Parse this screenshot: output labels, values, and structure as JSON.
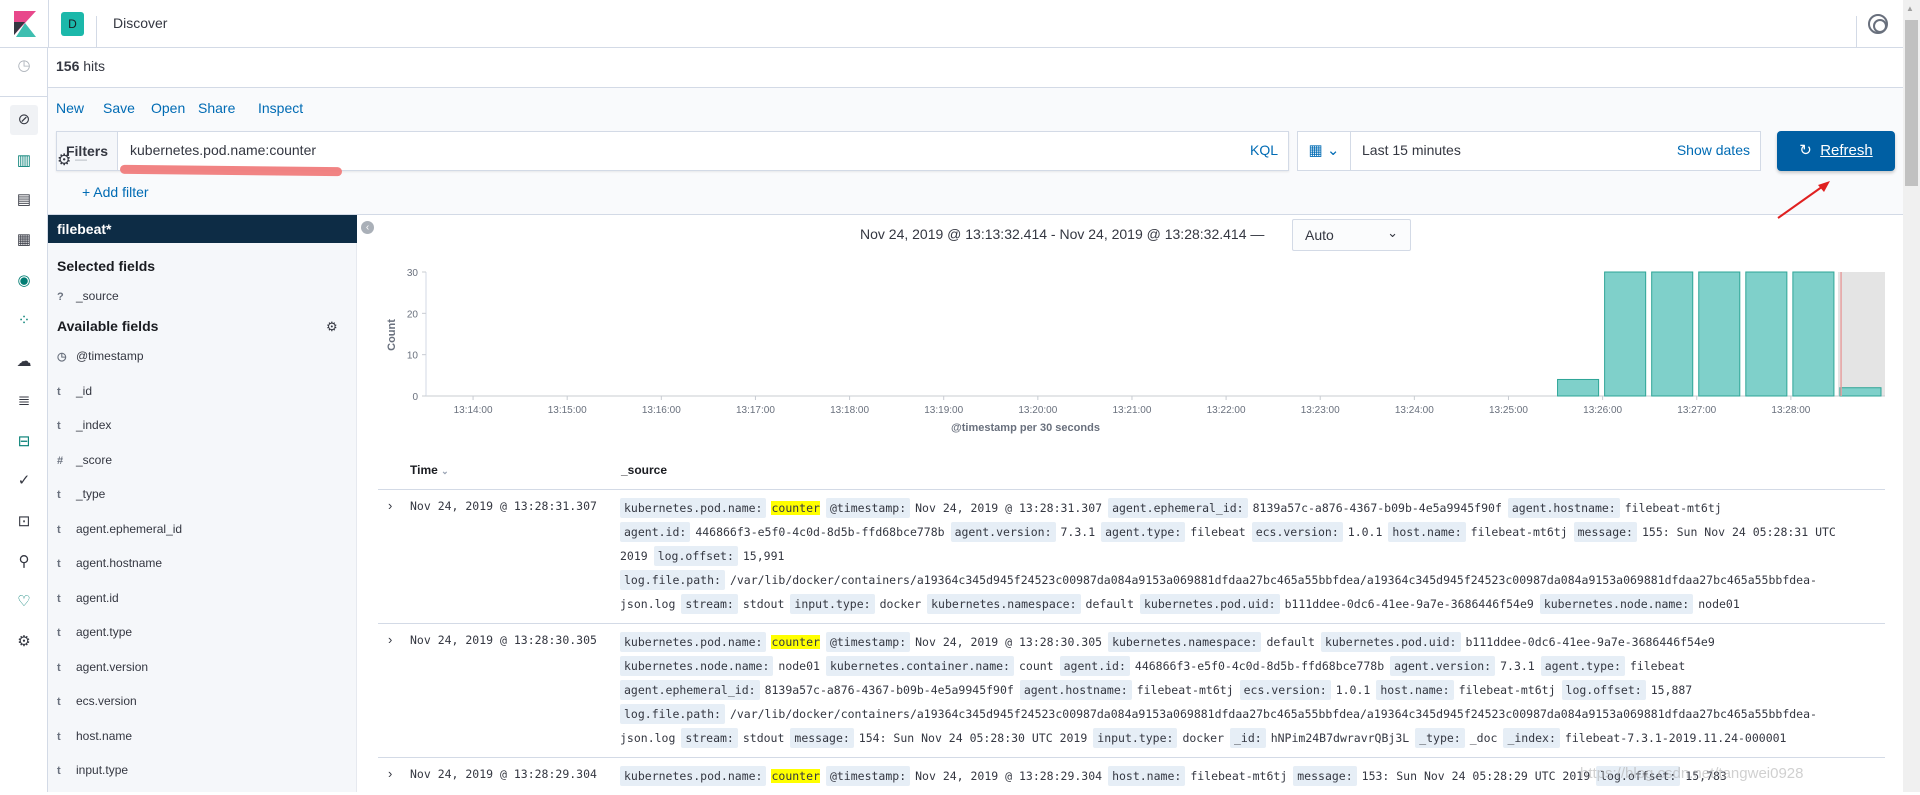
{
  "header": {
    "avatar_letter": "D",
    "title": "Discover"
  },
  "hits": {
    "count": "156",
    "label": "hits"
  },
  "toolbar": {
    "new": "New",
    "save": "Save",
    "open": "Open",
    "share": "Share",
    "inspect": "Inspect"
  },
  "query": {
    "filters_label": "Filters",
    "value": "kubernetes.pod.name:counter",
    "language": "KQL",
    "add_filter": "+ Add filter"
  },
  "time": {
    "quick": "Last 15 minutes",
    "show_dates": "Show dates",
    "refresh": "Refresh"
  },
  "sidebar": {
    "index_pattern": "filebeat*",
    "selected_title": "Selected fields",
    "selected": [
      {
        "type": "?",
        "name": "_source"
      }
    ],
    "available_title": "Available fields",
    "available": [
      {
        "type": "clock",
        "name": "@timestamp"
      },
      {
        "type": "t",
        "name": "_id"
      },
      {
        "type": "t",
        "name": "_index"
      },
      {
        "type": "#",
        "name": "_score"
      },
      {
        "type": "t",
        "name": "_type"
      },
      {
        "type": "t",
        "name": "agent.ephemeral_id"
      },
      {
        "type": "t",
        "name": "agent.hostname"
      },
      {
        "type": "t",
        "name": "agent.id"
      },
      {
        "type": "t",
        "name": "agent.type"
      },
      {
        "type": "t",
        "name": "agent.version"
      },
      {
        "type": "t",
        "name": "ecs.version"
      },
      {
        "type": "t",
        "name": "host.name"
      },
      {
        "type": "t",
        "name": "input.type"
      }
    ]
  },
  "histogram": {
    "range": "Nov 24, 2019 @ 13:13:32.414 - Nov 24, 2019 @ 13:28:32.414 —",
    "interval": "Auto"
  },
  "chart_data": {
    "type": "bar",
    "xlabel": "@timestamp per 30 seconds",
    "ylabel": "Count",
    "xlim": [
      "13:13:30",
      "13:29:00"
    ],
    "ylim": [
      0,
      30
    ],
    "y_ticks": [
      0,
      10,
      20,
      30
    ],
    "x_ticks": [
      "13:14:00",
      "13:15:00",
      "13:16:00",
      "13:17:00",
      "13:18:00",
      "13:19:00",
      "13:20:00",
      "13:21:00",
      "13:22:00",
      "13:23:00",
      "13:24:00",
      "13:25:00",
      "13:26:00",
      "13:27:00",
      "13:28:00"
    ],
    "x": [
      "13:25:30",
      "13:26:00",
      "13:26:30",
      "13:27:00",
      "13:27:30",
      "13:28:00",
      "13:28:30"
    ],
    "values": [
      4,
      30,
      30,
      30,
      30,
      30,
      2
    ],
    "partial_bucket_from": "13:28:30",
    "now_marker": "13:28:32",
    "bar_color": "#7fd0ca",
    "bar_stroke": "#2ea597"
  },
  "table": {
    "headers": {
      "time": "Time",
      "source": "_source"
    },
    "rows": [
      {
        "time": "Nov 24, 2019 @ 13:28:31.307",
        "lines": [
          [
            {
              "k": "kubernetes.pod.name:",
              "v": "counter",
              "hl": true
            },
            {
              "k": "@timestamp:",
              "v": "Nov 24, 2019 @ 13:28:31.307"
            },
            {
              "k": "agent.ephemeral_id:",
              "v": "8139a57c-a876-4367-b09b-4e5a9945f90f"
            },
            {
              "k": "agent.hostname:",
              "v": "filebeat-mt6tj"
            }
          ],
          [
            {
              "k": "agent.id:",
              "v": "446866f3-e5f0-4c0d-8d5b-ffd68bce778b"
            },
            {
              "k": "agent.version:",
              "v": "7.3.1"
            },
            {
              "k": "agent.type:",
              "v": "filebeat"
            },
            {
              "k": "ecs.version:",
              "v": "1.0.1"
            },
            {
              "k": "host.name:",
              "v": "filebeat-mt6tj"
            },
            {
              "k": "message:",
              "v": "155: Sun Nov 24 05:28:31 UTC"
            }
          ],
          [
            {
              "v": "2019"
            },
            {
              "k": "log.offset:",
              "v": "15,991"
            }
          ],
          [
            {
              "k": "log.file.path:",
              "v": "/var/lib/docker/containers/a19364c345d945f24523c00987da084a9153a069881dfdaa27bc465a55bbfdea/a19364c345d945f24523c00987da084a9153a069881dfdaa27bc465a55bbfdea-"
            }
          ],
          [
            {
              "v": "json.log"
            },
            {
              "k": "stream:",
              "v": "stdout"
            },
            {
              "k": "input.type:",
              "v": "docker"
            },
            {
              "k": "kubernetes.namespace:",
              "v": "default"
            },
            {
              "k": "kubernetes.pod.uid:",
              "v": "b111ddee-0dc6-41ee-9a7e-3686446f54e9"
            },
            {
              "k": "kubernetes.node.name:",
              "v": "node01"
            }
          ]
        ]
      },
      {
        "time": "Nov 24, 2019 @ 13:28:30.305",
        "lines": [
          [
            {
              "k": "kubernetes.pod.name:",
              "v": "counter",
              "hl": true
            },
            {
              "k": "@timestamp:",
              "v": "Nov 24, 2019 @ 13:28:30.305"
            },
            {
              "k": "kubernetes.namespace:",
              "v": "default"
            },
            {
              "k": "kubernetes.pod.uid:",
              "v": "b111ddee-0dc6-41ee-9a7e-3686446f54e9"
            }
          ],
          [
            {
              "k": "kubernetes.node.name:",
              "v": "node01"
            },
            {
              "k": "kubernetes.container.name:",
              "v": "count"
            },
            {
              "k": "agent.id:",
              "v": "446866f3-e5f0-4c0d-8d5b-ffd68bce778b"
            },
            {
              "k": "agent.version:",
              "v": "7.3.1"
            },
            {
              "k": "agent.type:",
              "v": "filebeat"
            }
          ],
          [
            {
              "k": "agent.ephemeral_id:",
              "v": "8139a57c-a876-4367-b09b-4e5a9945f90f"
            },
            {
              "k": "agent.hostname:",
              "v": "filebeat-mt6tj"
            },
            {
              "k": "ecs.version:",
              "v": "1.0.1"
            },
            {
              "k": "host.name:",
              "v": "filebeat-mt6tj"
            },
            {
              "k": "log.offset:",
              "v": "15,887"
            }
          ],
          [
            {
              "k": "log.file.path:",
              "v": "/var/lib/docker/containers/a19364c345d945f24523c00987da084a9153a069881dfdaa27bc465a55bbfdea/a19364c345d945f24523c00987da084a9153a069881dfdaa27bc465a55bbfdea-"
            }
          ],
          [
            {
              "v": "json.log"
            },
            {
              "k": "stream:",
              "v": "stdout"
            },
            {
              "k": "message:",
              "v": "154: Sun Nov 24 05:28:30 UTC 2019"
            },
            {
              "k": "input.type:",
              "v": "docker"
            },
            {
              "k": "_id:",
              "v": "hNPim24B7dwravrQBj3L"
            },
            {
              "k": "_type:",
              "v": "_doc"
            },
            {
              "k": "_index:",
              "v": "filebeat-7.3.1-2019.11.24-000001"
            }
          ]
        ]
      },
      {
        "time": "Nov 24, 2019 @ 13:28:29.304",
        "lines": [
          [
            {
              "k": "kubernetes.pod.name:",
              "v": "counter",
              "hl": true
            },
            {
              "k": "@timestamp:",
              "v": "Nov 24, 2019 @ 13:28:29.304"
            },
            {
              "k": "host.name:",
              "v": "filebeat-mt6tj"
            },
            {
              "k": "message:",
              "v": "153: Sun Nov 24 05:28:29 UTC 2019"
            },
            {
              "k": "log.offset:",
              "v": "15,783"
            }
          ]
        ]
      }
    ]
  },
  "watermark": "https://blog.csdn.net/tangwei0928"
}
